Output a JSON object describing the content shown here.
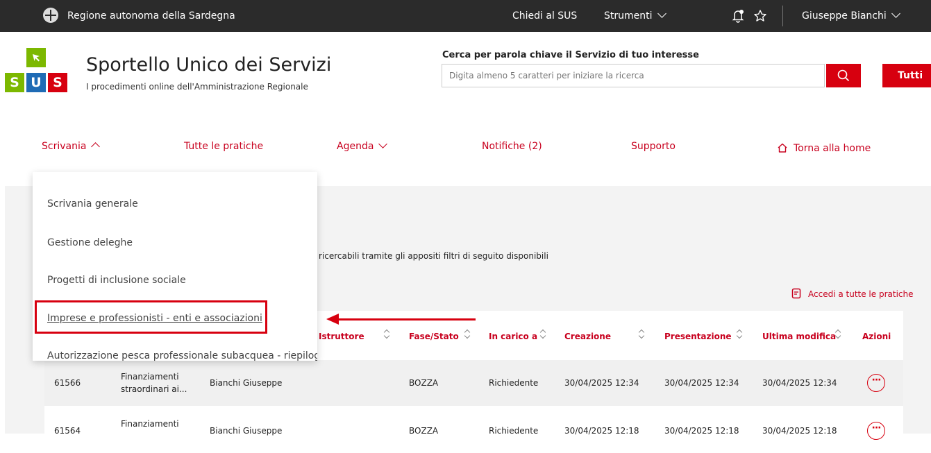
{
  "topbar": {
    "region": "Regione autonoma della Sardegna",
    "ask": "Chiedi al SUS",
    "tools": "Strumenti",
    "user": "Giuseppe Bianchi"
  },
  "brand": {
    "logo_letters": [
      "S",
      "U",
      "S"
    ],
    "title": "Sportello Unico dei Servizi",
    "subtitle": "I procedimenti online dell'Amministrazione Regionale"
  },
  "search": {
    "label": "Cerca per parola chiave il Servizio di tuo interesse",
    "placeholder": "Digita almeno 5 caratteri per iniziare la ricerca",
    "scope": "Tutti"
  },
  "nav": {
    "scrivania": "Scrivania",
    "pratiche": "Tutte le pratiche",
    "agenda": "Agenda",
    "notifiche": "Notifiche (2)",
    "supporto": "Supporto",
    "home": "Torna alla home"
  },
  "dropdown": {
    "items": [
      "Scrivania generale",
      "Gestione deleghe",
      "Progetti di inclusione sociale",
      "Imprese e professionisti - enti e associazioni",
      "Autorizzazione pesca professionale subacquea - riepilogo"
    ]
  },
  "main": {
    "intro": "ricercabili tramite gli appositi filtri di seguito disponibili",
    "access_all": "Accedi a tutte le pratiche"
  },
  "table": {
    "headers": [
      "Istruttore",
      "Fase/Stato",
      "In carico a",
      "Creazione",
      "Presentazione",
      "Ultima modifica",
      "Azioni"
    ],
    "rows": [
      {
        "id": "61566",
        "name1": "Finanziamenti",
        "name2": "straordinari ai...",
        "applicant": "Bianchi Giuseppe",
        "state": "BOZZA",
        "assignee": "Richiedente",
        "created": "30/04/2025 12:34",
        "submitted": "30/04/2025 12:34",
        "modified": "30/04/2025 12:34"
      },
      {
        "id": "61564",
        "name1": "Finanziamenti",
        "name2": "",
        "applicant": "Bianchi Giuseppe",
        "state": "BOZZA",
        "assignee": "Richiedente",
        "created": "30/04/2025 12:18",
        "submitted": "30/04/2025 12:18",
        "modified": "30/04/2025 12:18"
      }
    ]
  },
  "icons": {
    "crest": "region-crest-icon",
    "bell": "bell-icon",
    "star": "star-icon",
    "search": "search-icon",
    "home": "home-icon",
    "document": "document-icon",
    "actions": "more-actions-icon"
  },
  "colors": {
    "accent": "#d7000f",
    "topbar": "#2b2b2b",
    "logo_green": "#7cb800",
    "logo_blue": "#1f6bb5"
  }
}
